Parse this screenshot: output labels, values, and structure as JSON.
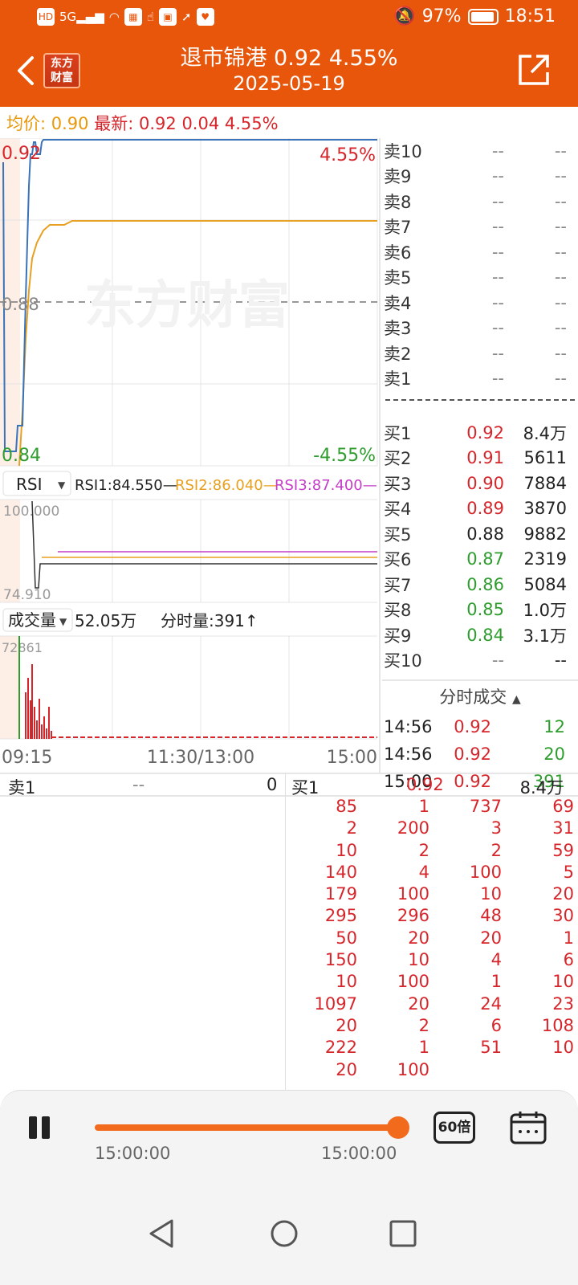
{
  "status": {
    "battery_text": "97%",
    "time": "18:51",
    "left_icons": [
      "HD",
      "5G",
      "signal",
      "wifi",
      "app",
      "app",
      "app",
      "app",
      "app"
    ]
  },
  "header": {
    "logo": [
      "东方",
      "财富"
    ],
    "title": "退市锦港  0.92  4.55%",
    "date": "2025-05-19"
  },
  "infobar": {
    "avg_label": "均价:",
    "avg_value": "0.90",
    "latest_label": "最新:",
    "latest_price": "0.92",
    "latest_change": "0.04",
    "latest_pct": "4.55%"
  },
  "price_chart": {
    "high_price": "0.92",
    "high_pct": "4.55%",
    "mid_price": "0.88",
    "low_price": "0.84",
    "low_pct": "-4.55%",
    "watermark": "东方财富"
  },
  "rsi": {
    "selector": "RSI",
    "rsi1": "RSI1:84.550—",
    "rsi2": "RSI2:86.040—",
    "rsi3": "RSI3:87.400—",
    "max": "100.000",
    "min": "74.910"
  },
  "volume": {
    "selector": "成交量",
    "total": "52.05万",
    "tick_label": "分时量:391↑",
    "max": "72861"
  },
  "time_axis": {
    "start": "09:15",
    "mid": "11:30/13:00",
    "end": "15:00"
  },
  "order_book": {
    "asks": [
      {
        "label": "卖10",
        "price": "--",
        "vol": "--"
      },
      {
        "label": "卖9",
        "price": "--",
        "vol": "--"
      },
      {
        "label": "卖8",
        "price": "--",
        "vol": "--"
      },
      {
        "label": "卖7",
        "price": "--",
        "vol": "--"
      },
      {
        "label": "卖6",
        "price": "--",
        "vol": "--"
      },
      {
        "label": "卖5",
        "price": "--",
        "vol": "--"
      },
      {
        "label": "卖4",
        "price": "--",
        "vol": "--"
      },
      {
        "label": "卖3",
        "price": "--",
        "vol": "--"
      },
      {
        "label": "卖2",
        "price": "--",
        "vol": "--"
      },
      {
        "label": "卖1",
        "price": "--",
        "vol": "--"
      }
    ],
    "bids": [
      {
        "label": "买1",
        "price": "0.92",
        "vol": "8.4万",
        "color": "#d6262b"
      },
      {
        "label": "买2",
        "price": "0.91",
        "vol": "5611",
        "color": "#d6262b"
      },
      {
        "label": "买3",
        "price": "0.90",
        "vol": "7884",
        "color": "#d6262b"
      },
      {
        "label": "买4",
        "price": "0.89",
        "vol": "3870",
        "color": "#d6262b"
      },
      {
        "label": "买5",
        "price": "0.88",
        "vol": "9882",
        "color": "#222222"
      },
      {
        "label": "买6",
        "price": "0.87",
        "vol": "2319",
        "color": "#2e9d2e"
      },
      {
        "label": "买7",
        "price": "0.86",
        "vol": "5084",
        "color": "#2e9d2e"
      },
      {
        "label": "买8",
        "price": "0.85",
        "vol": "1.0万",
        "color": "#2e9d2e"
      },
      {
        "label": "买9",
        "price": "0.84",
        "vol": "3.1万",
        "color": "#2e9d2e"
      },
      {
        "label": "买10",
        "price": "--",
        "vol": "--",
        "color": "#888888"
      }
    ]
  },
  "fenshi": {
    "title": "分时成交",
    "rows": [
      {
        "time": "14:56",
        "price": "0.92",
        "vol": "12"
      },
      {
        "time": "14:56",
        "price": "0.92",
        "vol": "20"
      },
      {
        "time": "15:00",
        "price": "0.92",
        "vol": "391"
      }
    ]
  },
  "queue": {
    "sell_label": "卖1",
    "sell_price": "--",
    "sell_count": "0",
    "buy_label": "买1",
    "buy_price": "0.92",
    "buy_vol": "8.4万",
    "rows": [
      [
        "85",
        "1",
        "737",
        "69"
      ],
      [
        "2",
        "200",
        "3",
        "31"
      ],
      [
        "10",
        "2",
        "2",
        "59"
      ],
      [
        "140",
        "4",
        "100",
        "5"
      ],
      [
        "179",
        "100",
        "10",
        "20"
      ],
      [
        "295",
        "296",
        "48",
        "30"
      ],
      [
        "50",
        "20",
        "20",
        "1"
      ],
      [
        "150",
        "10",
        "4",
        "6"
      ],
      [
        "10",
        "100",
        "1",
        "10"
      ],
      [
        "1097",
        "20",
        "24",
        "23"
      ],
      [
        "20",
        "2",
        "6",
        "108"
      ],
      [
        "222",
        "1",
        "51",
        "10"
      ],
      [
        "20",
        "100",
        "",
        ""
      ]
    ]
  },
  "player": {
    "start_time": "15:00:00",
    "end_time": "15:00:00",
    "speed": "60倍",
    "progress": 1.0
  },
  "colors": {
    "brand": "#e8560b",
    "up": "#d6262b",
    "down": "#2e9d2e",
    "avg_line": "#e8980a",
    "price_line": "#3a73b8",
    "rsi3": "#c43ec7"
  }
}
